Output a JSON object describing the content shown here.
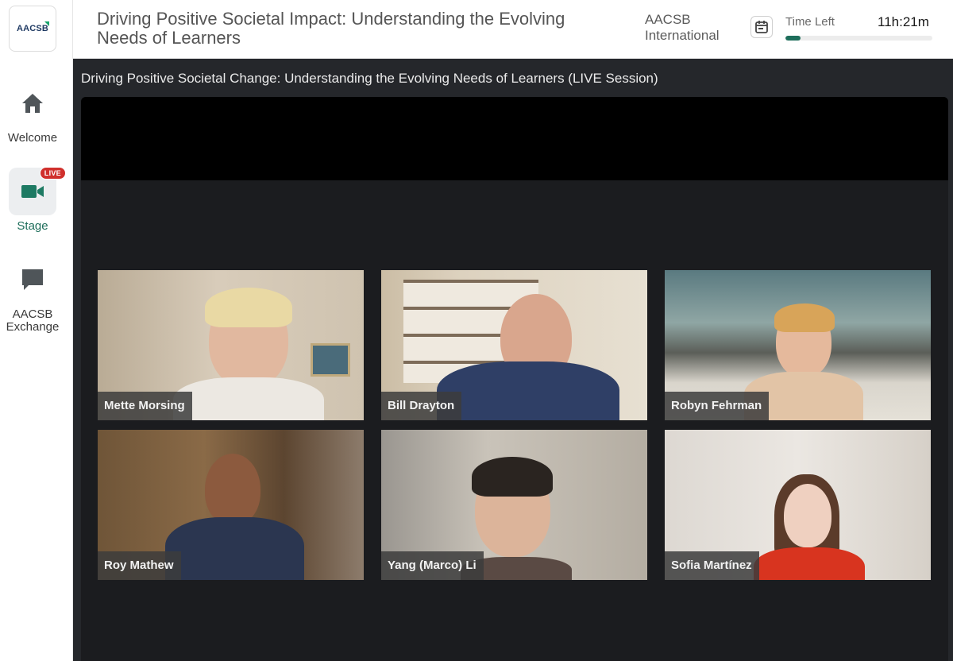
{
  "sidebar": {
    "logo": "AACSB",
    "items": [
      {
        "label": "Welcome",
        "icon": "home-icon"
      },
      {
        "label": "Stage",
        "icon": "video-camera-icon",
        "badge": "LIVE",
        "active": true
      },
      {
        "label": "AACSB Exchange",
        "icon": "chat-bubble-icon"
      }
    ]
  },
  "header": {
    "title": "Driving Positive Societal Impact: Understanding the Evolving Needs of Learners",
    "org": "AACSB International",
    "time_label": "Time Left",
    "time_value": "11h:21m",
    "calendar_icon": "calendar-icon",
    "progress_fraction": 0.1
  },
  "stage": {
    "session_title": "Driving Positive Societal Change: Understanding the Evolving Needs of Learners (LIVE Session)",
    "participants": [
      {
        "name": "Mette Morsing"
      },
      {
        "name": "Bill Drayton"
      },
      {
        "name": "Robyn Fehrman"
      },
      {
        "name": "Roy Mathew"
      },
      {
        "name": "Yang (Marco) Li"
      },
      {
        "name": "Sofia Martínez"
      }
    ]
  },
  "colors": {
    "accent": "#1e6e5b",
    "live_badge": "#d0302c",
    "stage_bg": "#25272b"
  }
}
